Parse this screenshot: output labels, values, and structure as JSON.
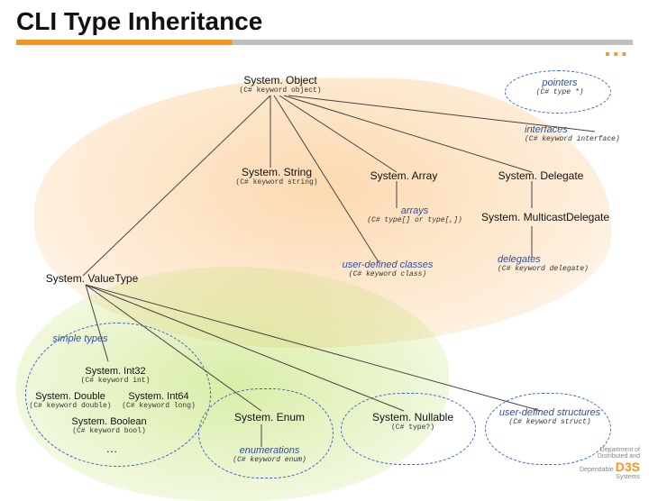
{
  "title": "CLI Type Inheritance",
  "dots": "...",
  "nodes": {
    "object": {
      "name": "System. Object",
      "sub": "(C# keyword object)"
    },
    "pointers": {
      "name": "pointers",
      "sub": "(C# type *)"
    },
    "interfaces": {
      "name": "interfaces",
      "sub": "(C# keyword interface)"
    },
    "string": {
      "name": "System. String",
      "sub": "(C# keyword string)"
    },
    "array": {
      "name": "System. Array"
    },
    "delegate": {
      "name": "System. Delegate"
    },
    "arrays": {
      "name": "arrays",
      "sub": "(C# type[] or type[,])"
    },
    "multicast": {
      "name": "System. MulticastDelegate"
    },
    "valuetype": {
      "name": "System. ValueType"
    },
    "userclasses": {
      "name": "user-defined classes",
      "sub": "(C# keyword class)"
    },
    "delegates": {
      "name": "delegates",
      "sub": "(C# keyword delegate)"
    },
    "simpletypes": {
      "name": "simple types"
    },
    "int32": {
      "name": "System. Int32",
      "sub": "(C# keyword int)"
    },
    "double": {
      "name": "System. Double",
      "sub": "(C# keyword double)"
    },
    "int64": {
      "name": "System. Int64",
      "sub": "(C# keyword long)"
    },
    "boolean": {
      "name": "System. Boolean",
      "sub": "(C# keyword bool)"
    },
    "more": {
      "name": "…"
    },
    "enum": {
      "name": "System. Enum"
    },
    "enumerations": {
      "name": "enumerations",
      "sub": "(C# keyword enum)"
    },
    "nullable": {
      "name": "System. Nullable",
      "sub": "(C# type?)"
    },
    "userstructs": {
      "name": "user-defined structures",
      "sub": "(C# keyword struct)"
    }
  },
  "footer": {
    "line1": "Department of",
    "line2": "Distributed and",
    "line3": "Dependable",
    "brand": "D3S",
    "sub": "Systems"
  }
}
